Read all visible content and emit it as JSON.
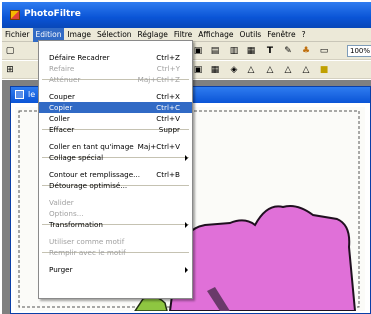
{
  "app": {
    "title": "PhotoFiltre"
  },
  "menubar": {
    "items": [
      "Fichier",
      "Edition",
      "Image",
      "Sélection",
      "Réglage",
      "Filtre",
      "Affichage",
      "Outils",
      "Fenêtre",
      "?"
    ],
    "active": "Edition"
  },
  "toolbar": {
    "zoom_value": "100%"
  },
  "document": {
    "title": "le"
  },
  "edit_menu": {
    "items": [
      {
        "label": "Défaire Recadrer",
        "shortcut": "Ctrl+Z",
        "enabled": true
      },
      {
        "label": "Refaire",
        "shortcut": "Ctrl+Y",
        "enabled": false
      },
      {
        "label": "Atténuer",
        "shortcut": "Maj+Ctrl+Z",
        "enabled": false
      },
      {
        "label": "Couper",
        "shortcut": "Ctrl+X",
        "enabled": true
      },
      {
        "label": "Copier",
        "shortcut": "Ctrl+C",
        "enabled": true,
        "selected": true
      },
      {
        "label": "Coller",
        "shortcut": "Ctrl+V",
        "enabled": true
      },
      {
        "label": "Effacer",
        "shortcut": "Suppr",
        "enabled": true
      },
      {
        "label": "Coller en tant qu'image",
        "shortcut": "Maj+Ctrl+V",
        "enabled": true
      },
      {
        "label": "Collage spécial",
        "shortcut": "",
        "enabled": true,
        "submenu": true
      },
      {
        "label": "Contour et remplissage...",
        "shortcut": "Ctrl+B",
        "enabled": true
      },
      {
        "label": "Détourage optimisé...",
        "shortcut": "",
        "enabled": true
      },
      {
        "label": "Valider",
        "shortcut": "",
        "enabled": false
      },
      {
        "label": "Options...",
        "shortcut": "",
        "enabled": false
      },
      {
        "label": "Transformation",
        "shortcut": "",
        "enabled": true,
        "submenu": true
      },
      {
        "label": "Utiliser comme motif",
        "shortcut": "",
        "enabled": false
      },
      {
        "label": "Remplir avec le motif",
        "shortcut": "",
        "enabled": false
      },
      {
        "label": "Purger",
        "shortcut": "",
        "enabled": true,
        "submenu": true
      }
    ]
  },
  "colors": {
    "selection": "#316ac5",
    "titlebar": "#0a54d6",
    "shape_pink": "#e070d8",
    "shape_green": "#8ec641"
  }
}
